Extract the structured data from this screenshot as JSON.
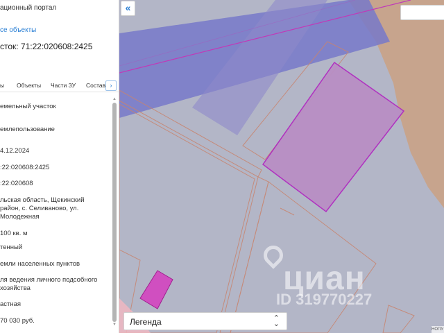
{
  "panel": {
    "portal_title": "ационный портал",
    "all_objects_link": "се объекты",
    "plot_title": "сток: 71:22:020608:2425",
    "tabs": [
      {
        "label": "ы"
      },
      {
        "label": "Объекты"
      },
      {
        "label": "Части ЗУ"
      },
      {
        "label": "Состав"
      }
    ],
    "tab_arrow": "›",
    "rows": [
      "емельный участок",
      "емлепользование",
      "4.12.2024",
      ":22:020608:2425",
      ":22:020608",
      "льская область, Щекинский район, с. Селиваново, ул. Молодежная",
      "100 кв. м",
      "тенный",
      "емли населенных пунктов",
      "ля ведения личного подсобного хозяйства",
      "астная",
      "70 030 руб."
    ]
  },
  "map": {
    "collapse_icon": "«",
    "legend_label": "Легенда",
    "legend_chevron": "⌃⌄",
    "watermark_brand": "циан",
    "watermark_id": "ID 319770227",
    "attribution": "НОПУ"
  },
  "colors": {
    "map_bg": "#b3b6c7",
    "blue_band": "#7779c9",
    "tan_area": "#c8a38a",
    "selected_plot_fill": "#b98fc4",
    "selected_plot_stroke": "#b02ac0",
    "parcel_stroke": "#c8846e",
    "small_plot": "#d04fc0",
    "link_blue": "#2a7fd4"
  }
}
